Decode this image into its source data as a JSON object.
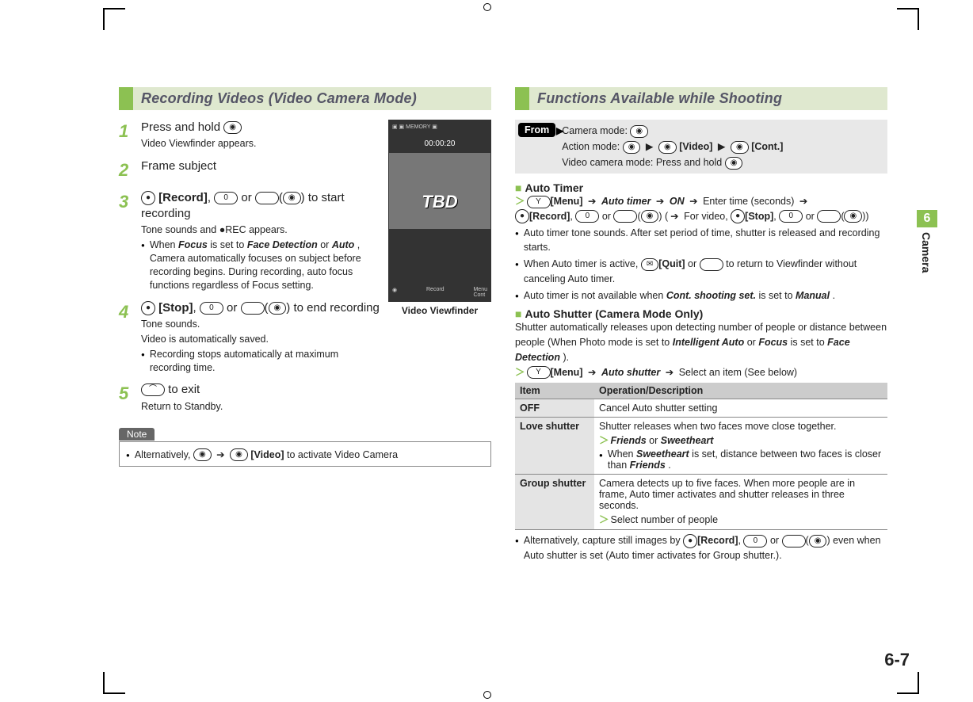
{
  "page_number": "6-7",
  "side_tab": {
    "number": "6",
    "label": "Camera"
  },
  "left": {
    "heading": "Recording Videos (Video Camera Mode)",
    "viewfinder_caption": "Video Viewfinder",
    "vf": {
      "timer": "00:00:20",
      "tbd": "TBD",
      "rec_label": "Record",
      "menu": "Menu",
      "cont": "Cont"
    },
    "steps": [
      {
        "num": "1",
        "main_pre": "Press and hold ",
        "main_post": "",
        "sub": "Video Viewfinder appears."
      },
      {
        "num": "2",
        "main_pre": "Frame subject",
        "main_post": ""
      },
      {
        "num": "3",
        "main_rich": {
          "pre": "",
          "record": "[Record]",
          "mid": ", ",
          "or": " or ",
          "tail": " to start recording"
        },
        "sub": "Tone sounds and ●REC appears.",
        "bullet": {
          "pre": "When ",
          "b1": "Focus",
          "mid1": " is set to ",
          "b2": "Face Detection",
          "or": " or ",
          "b3": "Auto",
          "tail": ", Camera automatically focuses on subject before recording begins. During recording, auto focus functions regardless of Focus setting."
        }
      },
      {
        "num": "4",
        "main_rich": {
          "stop": "[Stop]",
          "mid": ", ",
          "or": " or ",
          "tail": " to end recording"
        },
        "sub1": "Tone sounds.",
        "sub2": "Video is automatically saved.",
        "bullet_text": "Recording stops automatically at maximum recording time."
      },
      {
        "num": "5",
        "main_pre": "",
        "main_post": " to exit",
        "sub": "Return to Standby."
      }
    ],
    "note": {
      "label": "Note",
      "text_pre": "Alternatively, ",
      "arrow": "➔",
      "video": "[Video]",
      "text_post": " to activate Video Camera"
    }
  },
  "right": {
    "heading": "Functions Available while Shooting",
    "from": {
      "label": "From",
      "camera_mode": "Camera mode: ",
      "action_mode_pre": "Action mode: ",
      "video": "[Video]",
      "cont": "[Cont.]",
      "video_cam_mode": "Video camera mode: Press and hold "
    },
    "auto_timer": {
      "title": "Auto Timer",
      "line_menu": "[Menu]",
      "arrow": "➔",
      "item1": "Auto timer",
      "item2": "ON",
      "enter": " Enter time (seconds) ",
      "record": "[Record]",
      "or": " or ",
      "forvideo": " For video, ",
      "stop": "[Stop]",
      "bullet1": "Auto timer tone sounds. After set period of time, shutter is released and recording starts.",
      "bullet2_pre": "When Auto timer is active, ",
      "quit": "[Quit]",
      "bullet2_mid": " or ",
      "bullet2_post": " to return to Viewfinder without canceling Auto timer.",
      "bullet3_pre": "Auto timer is not available when ",
      "bullet3_b": "Cont. shooting set.",
      "bullet3_mid": " is set to ",
      "bullet3_b2": "Manual",
      "bullet3_post": "."
    },
    "auto_shutter": {
      "title": "Auto Shutter (Camera Mode Only)",
      "intro_pre": "Shutter automatically releases upon detecting number of people or distance between people (When Photo mode is set to ",
      "b1": "Intelligent Auto",
      "or": " or ",
      "b2": "Focus",
      "mid": " is set to ",
      "b3": "Face Detection",
      "post": ").",
      "menu": "[Menu]",
      "item": "Auto shutter",
      "select": " Select an item (See below)",
      "table": {
        "h1": "Item",
        "h2": "Operation/Description",
        "rows": [
          {
            "item": "OFF",
            "desc": "Cancel Auto shutter setting"
          },
          {
            "item": "Love shutter",
            "desc_line1": "Shutter releases when two faces move close together.",
            "opt_a": "Friends",
            "opt_or": " or ",
            "opt_b": "Sweetheart",
            "bullet_pre": "When ",
            "bullet_b": "Sweetheart",
            "bullet_mid": " is set, distance between two faces is closer than ",
            "bullet_b2": "Friends",
            "bullet_post": "."
          },
          {
            "item": "Group shutter",
            "desc": "Camera detects up to five faces. When more people are in frame, Auto timer activates and shutter releases in three seconds.",
            "select": "Select number of people"
          }
        ]
      },
      "tail_pre": "Alternatively, capture still images by ",
      "tail_record": "[Record]",
      "tail_or": " or ",
      "tail_post": " even when Auto shutter is set (Auto timer activates for Group shutter.)."
    }
  }
}
